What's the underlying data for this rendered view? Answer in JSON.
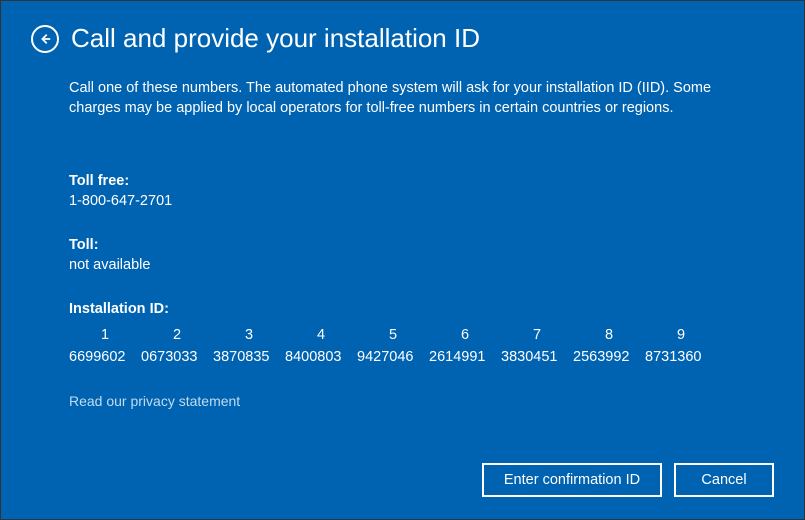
{
  "header": {
    "title": "Call and provide your installation ID"
  },
  "description": "Call one of these numbers. The automated phone system will ask for your installation ID (IID). Some charges may be applied by local operators for toll-free numbers in certain countries or regions.",
  "tollFree": {
    "label": "Toll free:",
    "value": "1-800-647-2701"
  },
  "toll": {
    "label": "Toll:",
    "value": "not available"
  },
  "installationId": {
    "label": "Installation ID:",
    "columns": [
      "1",
      "2",
      "3",
      "4",
      "5",
      "6",
      "7",
      "8",
      "9"
    ],
    "values": [
      "6699602",
      "0673033",
      "3870835",
      "8400803",
      "9427046",
      "2614991",
      "3830451",
      "2563992",
      "8731360"
    ]
  },
  "privacyLink": "Read our privacy statement",
  "buttons": {
    "enter": "Enter confirmation ID",
    "cancel": "Cancel"
  }
}
